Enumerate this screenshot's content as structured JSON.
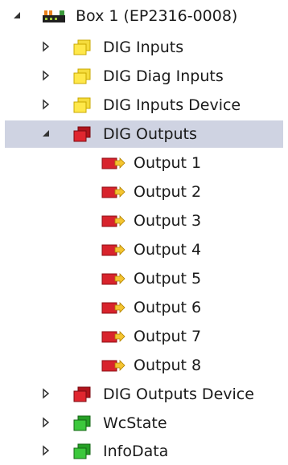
{
  "tree": {
    "root": {
      "label": "Box 1 (EP2316-0008)",
      "icon": "device-box-icon",
      "expanded": true
    },
    "groups": [
      {
        "label": "DIG Inputs",
        "icon": "input-group-icon",
        "color": "#f0d400",
        "expanded": false
      },
      {
        "label": "DIG Diag Inputs",
        "icon": "input-group-icon",
        "color": "#f0d400",
        "expanded": false
      },
      {
        "label": "DIG Inputs Device",
        "icon": "input-group-icon",
        "color": "#f0d400",
        "expanded": false
      },
      {
        "label": "DIG Outputs",
        "icon": "output-group-icon",
        "color": "#d0202a",
        "expanded": true,
        "selected": true
      },
      {
        "label": "DIG Outputs Device",
        "icon": "output-group-icon",
        "color": "#d0202a",
        "expanded": false
      },
      {
        "label": "WcState",
        "icon": "status-group-icon",
        "color": "#2db82d",
        "expanded": false
      },
      {
        "label": "InfoData",
        "icon": "status-group-icon",
        "color": "#2db82d",
        "expanded": false
      }
    ],
    "outputs": [
      {
        "label": "Output 1",
        "icon": "output-variable-icon"
      },
      {
        "label": "Output 2",
        "icon": "output-variable-icon"
      },
      {
        "label": "Output 3",
        "icon": "output-variable-icon"
      },
      {
        "label": "Output 4",
        "icon": "output-variable-icon"
      },
      {
        "label": "Output 5",
        "icon": "output-variable-icon"
      },
      {
        "label": "Output 6",
        "icon": "output-variable-icon"
      },
      {
        "label": "Output 7",
        "icon": "output-variable-icon"
      },
      {
        "label": "Output 8",
        "icon": "output-variable-icon"
      }
    ]
  }
}
